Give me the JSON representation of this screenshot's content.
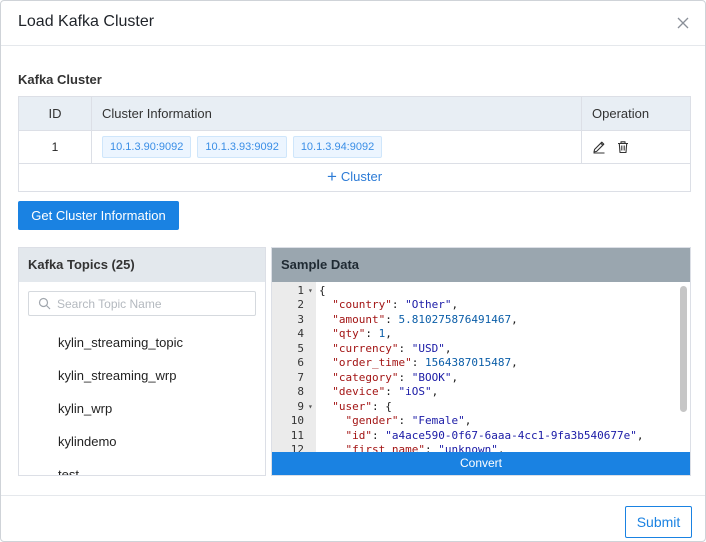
{
  "dialog": {
    "title": "Load Kafka Cluster"
  },
  "cluster_section": {
    "label": "Kafka Cluster",
    "columns": [
      "ID",
      "Cluster Information",
      "Operation"
    ],
    "rows": [
      {
        "id": "1",
        "brokers": [
          "10.1.3.90:9092",
          "10.1.3.93:9092",
          "10.1.3.94:9092"
        ]
      }
    ],
    "add_label": "Cluster"
  },
  "get_info_button": "Get Cluster Information",
  "topics": {
    "title": "Kafka Topics (25)",
    "search_placeholder": "Search Topic Name",
    "items": [
      "kylin_streaming_topic",
      "kylin_streaming_wrp",
      "kylin_wrp",
      "kylindemo",
      "test"
    ]
  },
  "sample": {
    "title": "Sample Data",
    "convert_label": "Convert",
    "lines": [
      {
        "n": "1",
        "fold": true,
        "indent": 0,
        "text": "{"
      },
      {
        "n": "2",
        "fold": false,
        "indent": 2,
        "key": "country",
        "value": "\"Other\"",
        "vtype": "s",
        "trail": ","
      },
      {
        "n": "3",
        "fold": false,
        "indent": 2,
        "key": "amount",
        "value": "5.810275876491467",
        "vtype": "n",
        "trail": ","
      },
      {
        "n": "4",
        "fold": false,
        "indent": 2,
        "key": "qty",
        "value": "1",
        "vtype": "n",
        "trail": ","
      },
      {
        "n": "5",
        "fold": false,
        "indent": 2,
        "key": "currency",
        "value": "\"USD\"",
        "vtype": "s",
        "trail": ","
      },
      {
        "n": "6",
        "fold": false,
        "indent": 2,
        "key": "order_time",
        "value": "1564387015487",
        "vtype": "n",
        "trail": ","
      },
      {
        "n": "7",
        "fold": false,
        "indent": 2,
        "key": "category",
        "value": "\"BOOK\"",
        "vtype": "s",
        "trail": ","
      },
      {
        "n": "8",
        "fold": false,
        "indent": 2,
        "key": "device",
        "value": "\"iOS\"",
        "vtype": "s",
        "trail": ","
      },
      {
        "n": "9",
        "fold": true,
        "indent": 2,
        "key": "user",
        "value": "{",
        "vtype": "p",
        "trail": ""
      },
      {
        "n": "10",
        "fold": false,
        "indent": 4,
        "key": "gender",
        "value": "\"Female\"",
        "vtype": "s",
        "trail": ","
      },
      {
        "n": "11",
        "fold": false,
        "indent": 4,
        "key": "id",
        "value": "\"a4ace590-0f67-6aaa-4cc1-9fa3b540677e\"",
        "vtype": "s",
        "trail": ","
      },
      {
        "n": "12",
        "fold": false,
        "indent": 4,
        "key": "first_name",
        "value": "\"unknown\"",
        "vtype": "s",
        "trail": ","
      }
    ]
  },
  "submit_button": "Submit",
  "colors": {
    "primary": "#1a82e2",
    "header_bg": "#e8eef4",
    "tag_bg": "#ecf5ff",
    "sample_head": "#9aa6af"
  },
  "icons": {
    "close": "close-icon",
    "edit": "edit-icon",
    "delete": "trash-icon",
    "search": "search-icon",
    "fold": "caret-down-icon"
  }
}
